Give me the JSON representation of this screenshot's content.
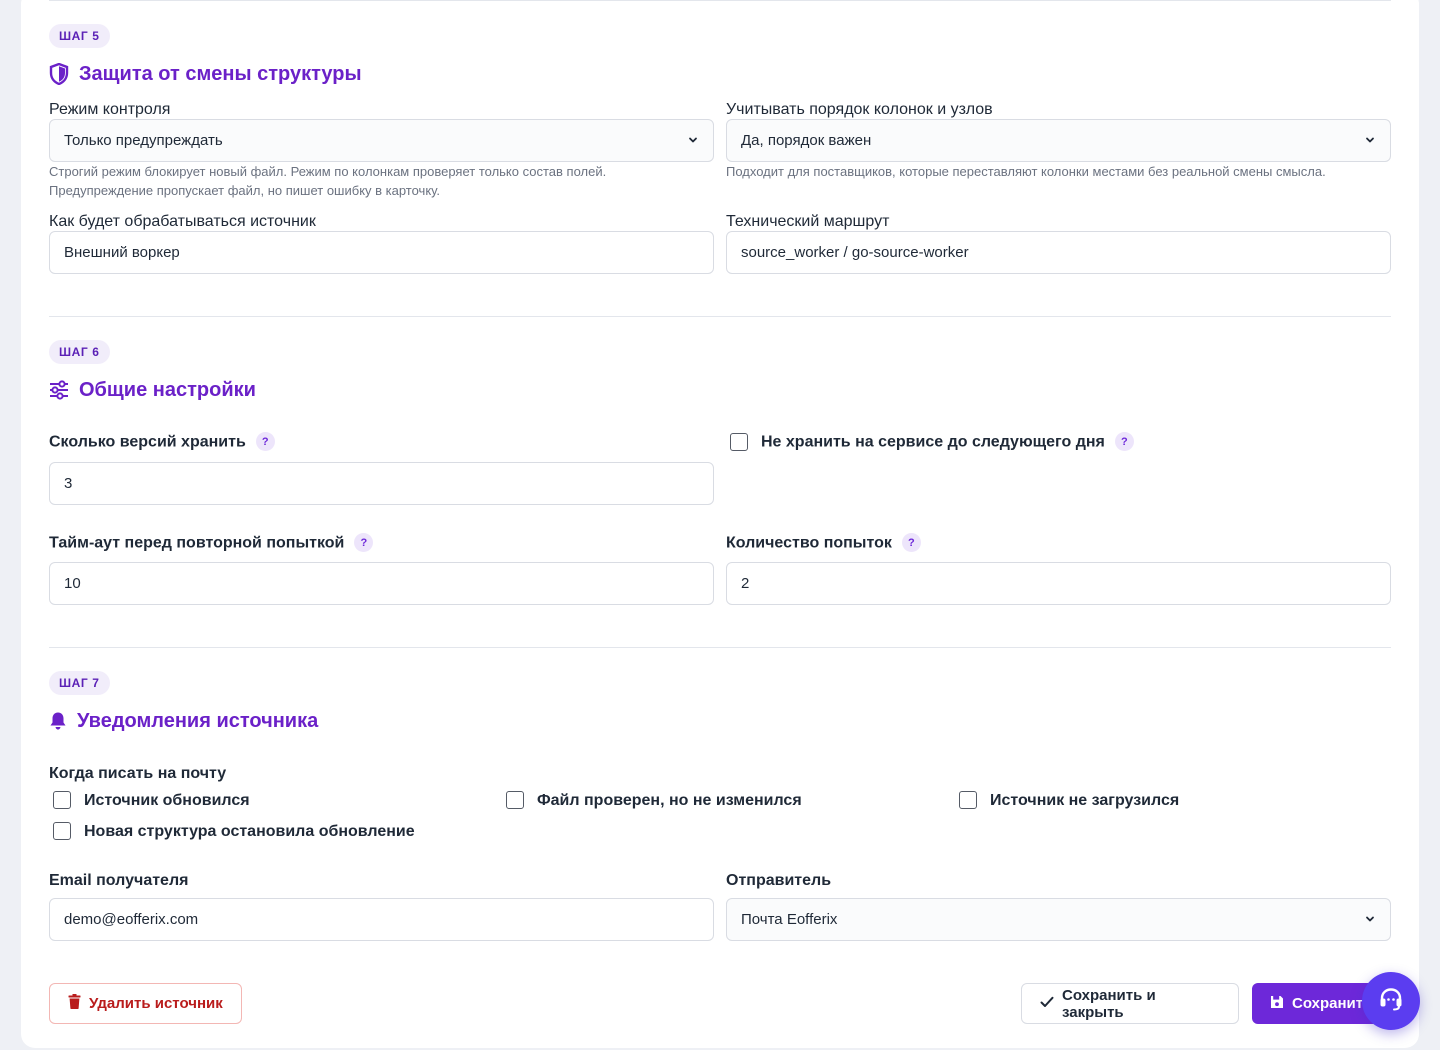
{
  "step5": {
    "badge": "ШАГ 5",
    "title": "Защита от смены структуры",
    "control_mode": {
      "label": "Режим контроля",
      "value": "Только предупреждать",
      "hint_line1": "Строгий режим блокирует новый файл. Режим по колонкам проверяет только состав полей.",
      "hint_line2": "Предупреждение пропускает файл, но пишет ошибку в карточку."
    },
    "column_order": {
      "label": "Учитывать порядок колонок и узлов",
      "value": "Да, порядок важен",
      "hint": "Подходит для поставщиков, которые переставляют колонки местами без реальной смены смысла."
    },
    "processing": {
      "label": "Как будет обрабатываться источник",
      "value": "Внешний воркер"
    },
    "route": {
      "label": "Технический маршрут",
      "value": "source_worker / go-source-worker"
    }
  },
  "step6": {
    "badge": "ШАГ 6",
    "title": "Общие настройки",
    "versions": {
      "label": "Сколько версий хранить",
      "value": "3"
    },
    "no_store": {
      "label": "Не хранить на сервисе до следующего дня",
      "checked": false
    },
    "timeout": {
      "label": "Тайм-аут перед повторной попыткой",
      "value": "10"
    },
    "attempts": {
      "label": "Количество попыток",
      "value": "2"
    },
    "help_symbol": "?"
  },
  "step7": {
    "badge": "ШАГ 7",
    "title": "Уведомления источника",
    "when_label": "Когда писать на почту",
    "options": [
      {
        "label": "Источник обновился",
        "checked": false
      },
      {
        "label": "Файл проверен, но не изменился",
        "checked": false
      },
      {
        "label": "Источник не загрузился",
        "checked": false
      },
      {
        "label": "Новая структура остановила обновление",
        "checked": false
      }
    ],
    "email": {
      "label": "Email получателя",
      "value": "demo@eofferix.com"
    },
    "sender": {
      "label": "Отправитель",
      "value": "Почта Eofferix"
    }
  },
  "actions": {
    "delete": "Удалить источник",
    "save_close": "Сохранить и закрыть",
    "save": "Сохранить"
  },
  "icons": {
    "step5": "shield-icon",
    "step6": "sliders-icon",
    "step7": "bell-icon",
    "delete": "trash-icon",
    "save_close": "check-icon",
    "save": "floppy-icon",
    "fab": "headset-icon",
    "select": "chevron-down-icon"
  },
  "colors": {
    "accent": "#6b21c8",
    "primary_button": "#6d28d9",
    "danger": "#b91c1c",
    "fab": "#5b3df0"
  }
}
